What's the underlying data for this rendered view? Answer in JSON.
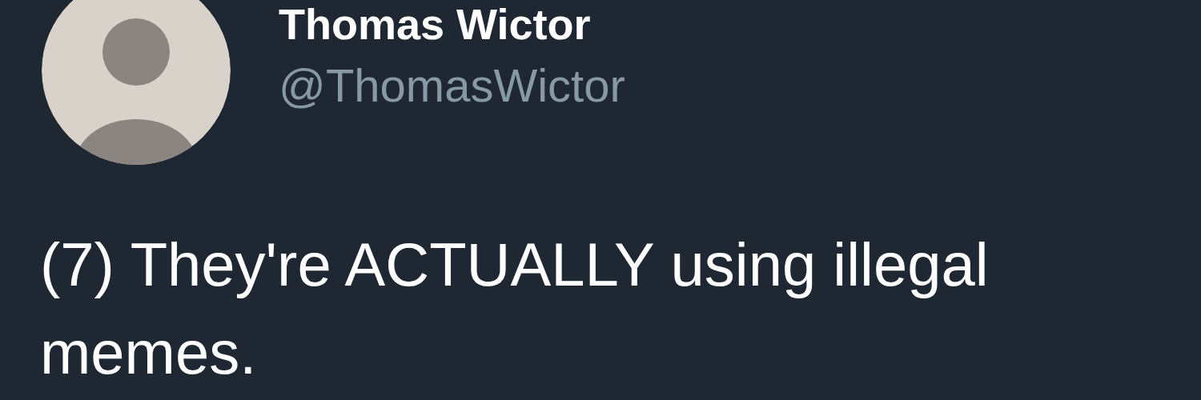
{
  "author": {
    "name": "Thomas Wictor",
    "handle": "@ThomasWictor"
  },
  "tweet": {
    "text": "(7) They're ACTUALLY using illegal memes."
  }
}
